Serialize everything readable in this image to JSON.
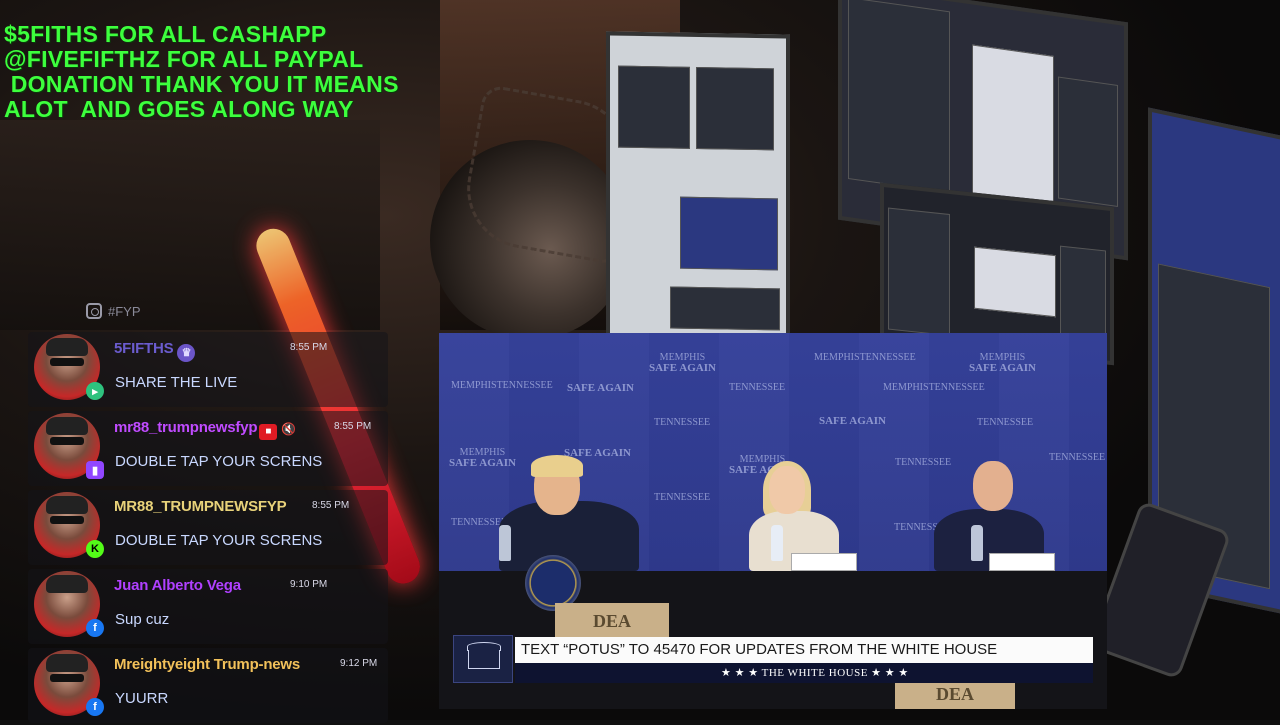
{
  "banner": {
    "lines": [
      "$5FITHS FOR ALL CASHAPP",
      "@FIVEFIFTHZ FOR ALL PAYPAL",
      " DONATION THANK YOU IT MEANS",
      "ALOT  AND GOES ALONG WAY"
    ],
    "color": "#3dff3d"
  },
  "tag": {
    "icon": "instagram-icon",
    "text": "#FYP"
  },
  "chat": [
    {
      "username": "5FIFTHS",
      "username_color": "#6b5ccf",
      "badges": [
        "crown-icon"
      ],
      "time": "8:55 PM",
      "platform": "kick",
      "message": "SHARE THE LIVE"
    },
    {
      "username": "mr88_trumpnewsfyp",
      "username_color": "#c04bff",
      "badges": [
        "camera-icon",
        "mute-icon"
      ],
      "time": "8:55 PM",
      "platform": "twitch",
      "message": "DOUBLE TAP YOUR SCRENS"
    },
    {
      "username": "MR88_TRUMPNEWSFYP",
      "username_color": "#e8d27a",
      "badges": [],
      "time": "8:55 PM",
      "platform": "kick",
      "message": "DOUBLE TAP YOUR SCRENS"
    },
    {
      "username": "Juan Alberto Vega",
      "username_color": "#b040ff",
      "badges": [],
      "time": "9:10 PM",
      "platform": "facebook",
      "message": "Sup cuz"
    },
    {
      "username": "Mreightyeight Trump-news",
      "username_color": "#f2c15a",
      "badges": [],
      "time": "9:12 PM",
      "platform": "facebook",
      "message": "YUURR"
    }
  ],
  "video": {
    "backdrop_logos": {
      "top": "MEMPHIS",
      "main": "SAFE AGAIN",
      "sub": "TENNESSEE"
    },
    "lower_third": {
      "headline": "TEXT “POTUS” TO 45470 FOR UPDATES FROM THE WHITE HOUSE",
      "channel": "★ ★ ★  THE WHITE HOUSE  ★ ★ ★"
    },
    "props": {
      "box_label": "DEA"
    }
  }
}
